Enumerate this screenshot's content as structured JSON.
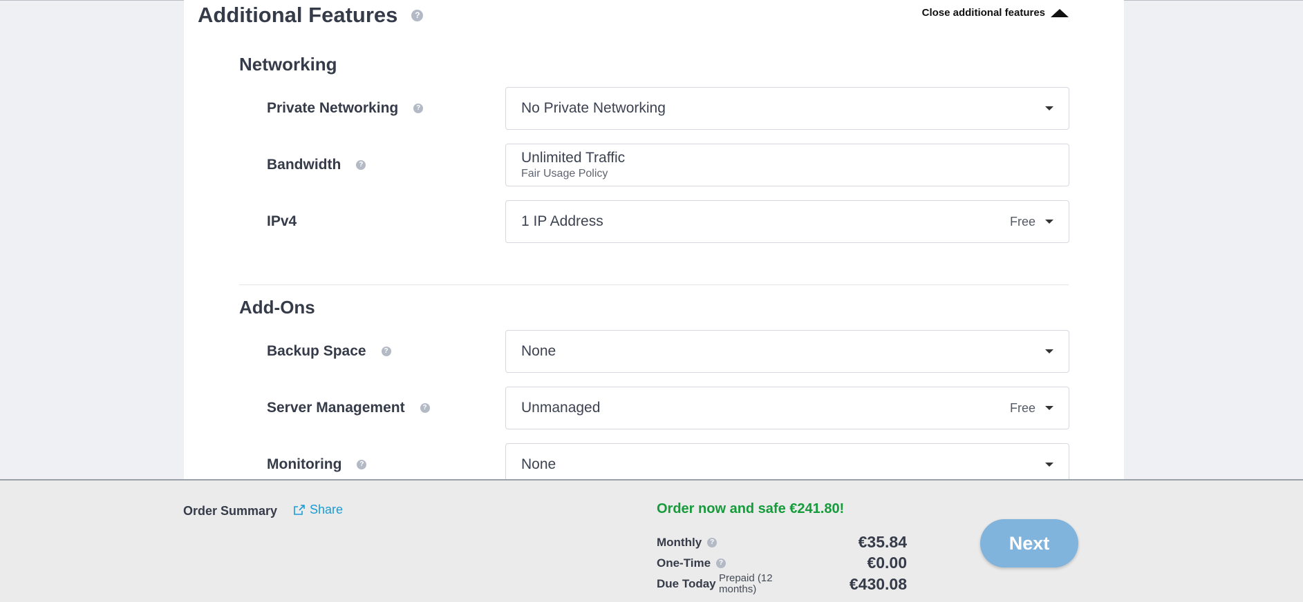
{
  "features": {
    "title": "Additional Features",
    "close_label": "Close additional features"
  },
  "networking": {
    "title": "Networking",
    "rows": [
      {
        "label": "Private Networking",
        "value": "No Private Networking",
        "extra": ""
      },
      {
        "label": "Bandwidth",
        "value": "Unlimited Traffic",
        "sub": "Fair Usage Policy"
      },
      {
        "label": "IPv4",
        "value": "1 IP Address",
        "extra": "Free"
      }
    ]
  },
  "addons": {
    "title": "Add-Ons",
    "rows": [
      {
        "label": "Backup Space",
        "value": "None",
        "extra": ""
      },
      {
        "label": "Server Management",
        "value": "Unmanaged",
        "extra": "Free"
      },
      {
        "label": "Monitoring",
        "value": "None",
        "extra": ""
      }
    ]
  },
  "icons": {
    "help": "question-mark-icon",
    "share": "share-icon",
    "collapse": "triangle-up-icon",
    "dropdown": "caret-down-icon"
  },
  "summary": {
    "title": "Order Summary",
    "share_label": "Share",
    "promo": "Order now and safe €241.80!",
    "monthly_label": "Monthly",
    "monthly_amount": "€35.84",
    "onetime_label": "One-Time",
    "onetime_amount": "€0.00",
    "due_label": "Due Today",
    "due_note": "Prepaid (12 months)",
    "due_amount": "€430.08",
    "next_label": "Next"
  },
  "colors": {
    "promo": "#169b3b",
    "link": "#1a9bd7",
    "button": "#80b4dc"
  }
}
